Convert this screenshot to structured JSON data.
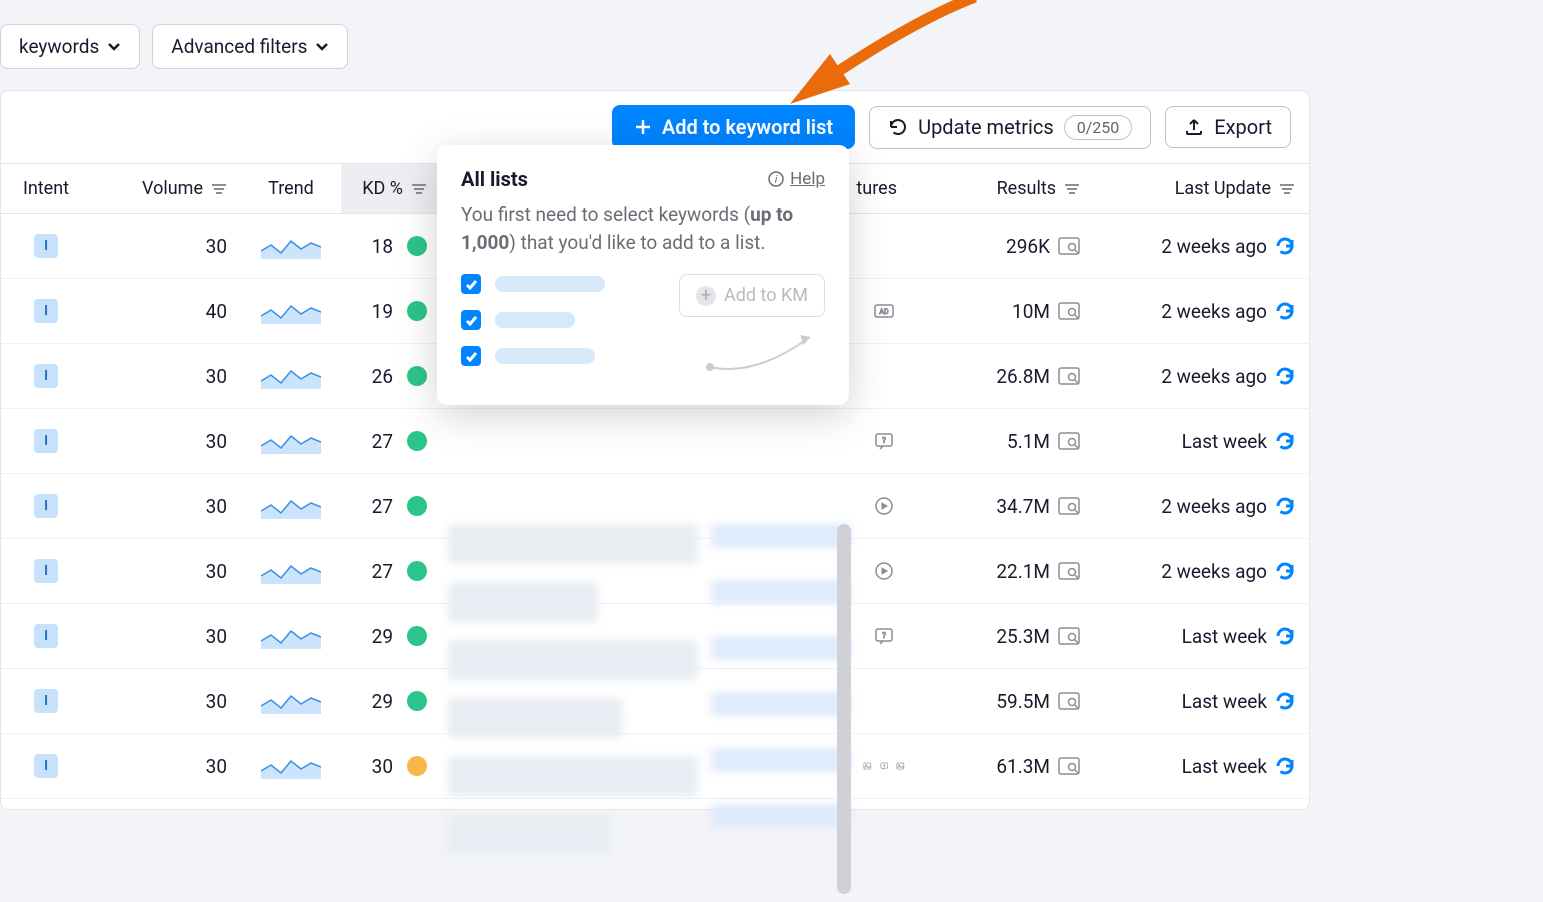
{
  "filters": {
    "keywords_label": "keywords",
    "advanced_label": "Advanced filters"
  },
  "toolbar": {
    "add_label": "Add to keyword list",
    "update_label": "Update metrics",
    "update_count": "0/250",
    "export_label": "Export"
  },
  "popover": {
    "title": "All lists",
    "help": "Help",
    "desc_pre": "You first need to select keywords (",
    "desc_bold": "up to 1,000",
    "desc_post": ") that you'd like to add to a list.",
    "add_km_label": "Add to KM"
  },
  "columns": {
    "intent": "Intent",
    "volume": "Volume",
    "trend": "Trend",
    "kd": "KD %",
    "serp": "tures",
    "results": "Results",
    "last_update": "Last Update"
  },
  "intent_code": "I",
  "rows": [
    {
      "volume": "30",
      "kd": "18",
      "kd_color": "green",
      "results": "296K",
      "last": "2 weeks ago",
      "serp": ""
    },
    {
      "volume": "40",
      "kd": "19",
      "kd_color": "green",
      "results": "10M",
      "last": "2 weeks ago",
      "serp": "ad"
    },
    {
      "volume": "30",
      "kd": "26",
      "kd_color": "green",
      "results": "26.8M",
      "last": "2 weeks ago",
      "serp": ""
    },
    {
      "volume": "30",
      "kd": "27",
      "kd_color": "green",
      "results": "5.1M",
      "last": "Last week",
      "serp": "faq"
    },
    {
      "volume": "30",
      "kd": "27",
      "kd_color": "green",
      "results": "34.7M",
      "last": "2 weeks ago",
      "serp": "video"
    },
    {
      "volume": "30",
      "kd": "27",
      "kd_color": "green",
      "results": "22.1M",
      "last": "2 weeks ago",
      "serp": "video"
    },
    {
      "volume": "30",
      "kd": "29",
      "kd_color": "green",
      "results": "25.3M",
      "last": "Last week",
      "serp": "faq"
    },
    {
      "volume": "30",
      "kd": "29",
      "kd_color": "green",
      "results": "59.5M",
      "last": "Last week",
      "serp": ""
    },
    {
      "volume": "30",
      "kd": "30",
      "kd_color": "orange",
      "results": "61.3M",
      "last": "Last week",
      "serp": "img-faq-img"
    }
  ]
}
